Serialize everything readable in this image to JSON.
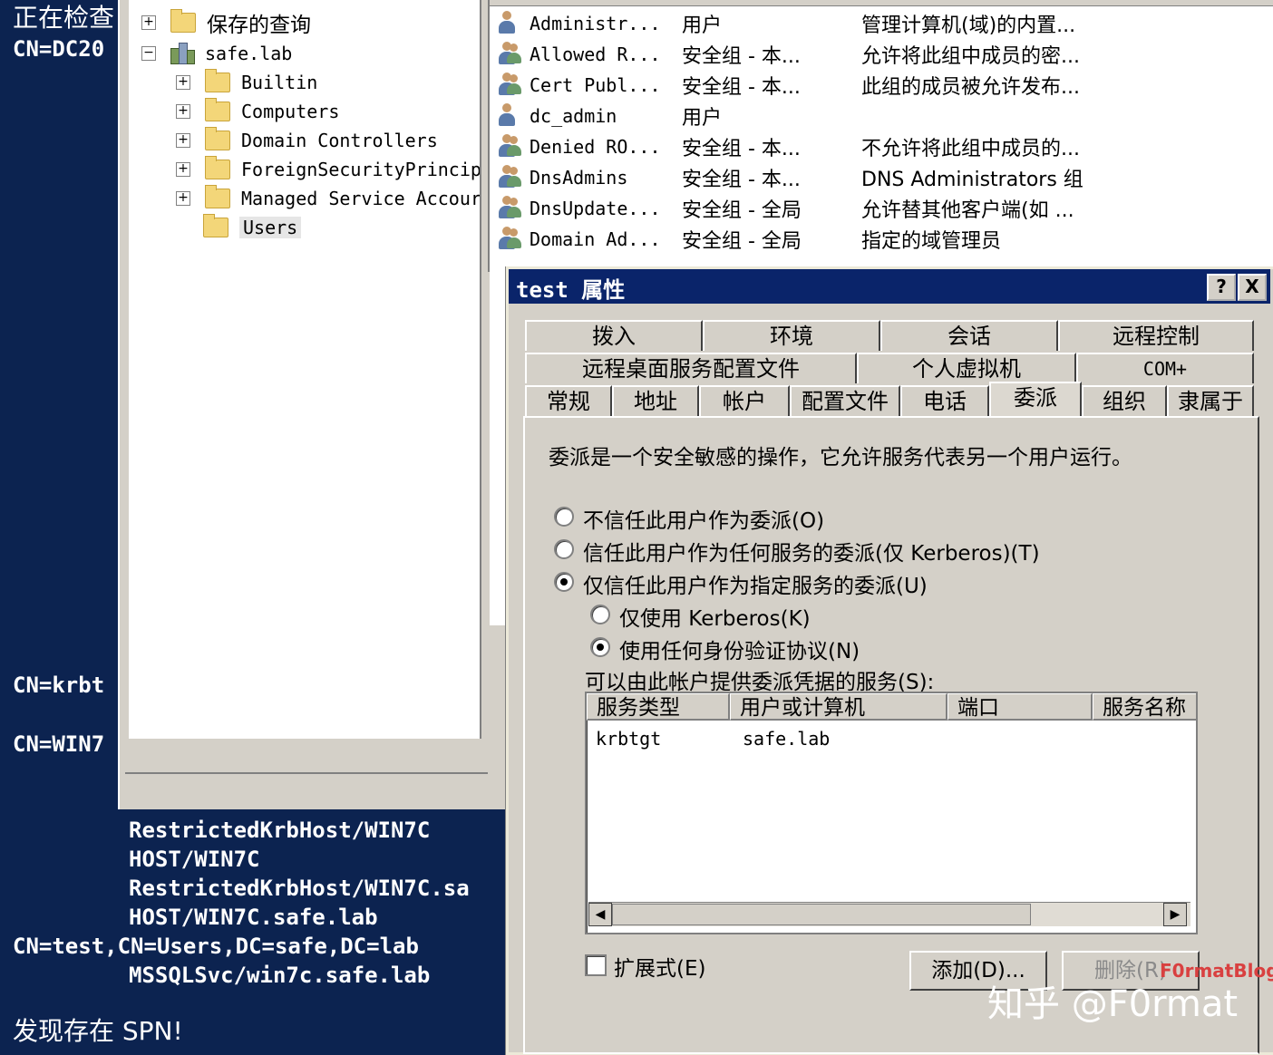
{
  "console": {
    "lines": {
      "l1": "正在检查",
      "l2": "CN=DC20",
      "l3": "CN=krbt",
      "l4": "CN=WIN7",
      "l5": "RestrictedKrbHost/WIN7C",
      "l6": "HOST/WIN7C",
      "l7": "RestrictedKrbHost/WIN7C.sa",
      "l8": "HOST/WIN7C.safe.lab",
      "l9": "CN=test,CN=Users,DC=safe,DC=lab",
      "l10": "MSSQLSvc/win7c.safe.lab",
      "l11": "发现存在 SPN!"
    }
  },
  "mmc": {
    "tree": {
      "saved_queries": "保存的查询",
      "domain": "safe.lab",
      "builtin": "Builtin",
      "computers": "Computers",
      "domain_controllers": "Domain Controllers",
      "fsp": "ForeignSecurityPrincip",
      "msa": "Managed Service Accour",
      "users": "Users"
    },
    "list": [
      {
        "name": "Administr...",
        "type": "用户",
        "desc": "管理计算机(域)的内置...",
        "icon": "user-icon"
      },
      {
        "name": "Allowed R...",
        "type": "安全组 - 本...",
        "desc": "允许将此组中成员的密...",
        "icon": "group-icon"
      },
      {
        "name": "Cert Publ...",
        "type": "安全组 - 本...",
        "desc": "此组的成员被允许发布...",
        "icon": "group-icon"
      },
      {
        "name": "dc_admin",
        "type": "用户",
        "desc": "",
        "icon": "user-icon"
      },
      {
        "name": "Denied RO...",
        "type": "安全组 - 本...",
        "desc": "不允许将此组中成员的...",
        "icon": "group-icon"
      },
      {
        "name": "DnsAdmins",
        "type": "安全组 - 本...",
        "desc": "DNS Administrators 组",
        "icon": "group-icon"
      },
      {
        "name": "DnsUpdate...",
        "type": "安全组 - 全局",
        "desc": "允许替其他客户端(如 ...",
        "icon": "group-icon"
      },
      {
        "name": "Domain Ad...",
        "type": "安全组 - 全局",
        "desc": "指定的域管理员",
        "icon": "group-icon"
      }
    ]
  },
  "dialog": {
    "title": "test 属性",
    "help_btn": "?",
    "close_btn": "X",
    "tabs_row1": [
      "拨入",
      "环境",
      "会话",
      "远程控制"
    ],
    "tabs_row2": [
      "远程桌面服务配置文件",
      "个人虚拟机",
      "COM+"
    ],
    "tabs_row3": [
      "常规",
      "地址",
      "帐户",
      "配置文件",
      "电话",
      "委派",
      "组织",
      "隶属于"
    ],
    "intro": "委派是一个安全敏感的操作，它允许服务代表另一个用户运行。",
    "opt_none": "不信任此用户作为委派(O)",
    "opt_any": "信任此用户作为任何服务的委派(仅 Kerberos)(T)",
    "opt_specified": "仅信任此用户作为指定服务的委派(U)",
    "opt_kerb_only": "仅使用 Kerberos(K)",
    "opt_any_proto": "使用任何身份验证协议(N)",
    "services_label": "可以由此帐户提供委派凭据的服务(S):",
    "columns": [
      "服务类型",
      "用户或计算机",
      "端口",
      "服务名称"
    ],
    "rows": [
      {
        "type": "krbtgt",
        "host": "safe.lab",
        "port": "",
        "name": ""
      }
    ],
    "expanded": "扩展式(E)",
    "add_btn": "添加(D)...",
    "remove_btn": "删除(R)"
  },
  "watermark": {
    "brand": "知乎 @F0rmat",
    "blog": "F0rmatBlog"
  }
}
